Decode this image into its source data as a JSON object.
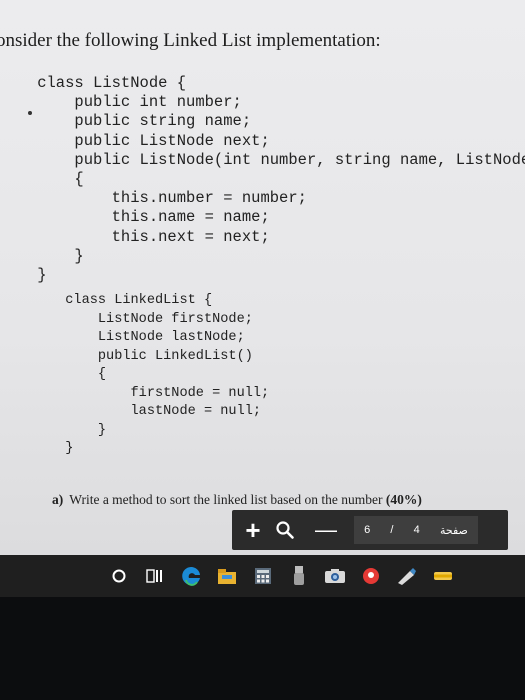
{
  "heading": "onsider the following Linked List implementation:",
  "code_listnode": [
    "    class ListNode {",
    "        public int number;",
    "        public string name;",
    "        public ListNode next;",
    "        public ListNode(int number, string name, ListNode",
    "        {",
    "            this.number = number;",
    "            this.name = name;",
    "            this.next = next;",
    "        }",
    "    }"
  ],
  "code_linkedlist": [
    "        class LinkedList {",
    "            ListNode firstNode;",
    "            ListNode lastNode;",
    "            public LinkedList()",
    "            {",
    "                firstNode = null;",
    "                lastNode = null;",
    "            }",
    "        }"
  ],
  "question": {
    "label": "a)",
    "text": "Write a method to sort the linked list based on the number",
    "percent": "(40%)"
  },
  "toolbar": {
    "plus": "+",
    "minus": "—",
    "page_current": "6",
    "page_sep": "/",
    "page_total": "4",
    "page_word": "صفحة"
  },
  "icons": [
    "plus-icon",
    "zoom-icon",
    "minus-icon",
    "cortana-circle-icon",
    "task-view-icon",
    "edge-icon",
    "file-explorer-icon",
    "calculator-icon",
    "usb-icon",
    "camera-icon",
    "maps-icon",
    "paint-icon",
    "pen-icon"
  ],
  "colors": {
    "toolbar_bg": "#2b2b2b",
    "taskbar_bg": "#1f1f1f",
    "edge_blue": "#1b8bd6",
    "maps_red": "#e53935"
  }
}
